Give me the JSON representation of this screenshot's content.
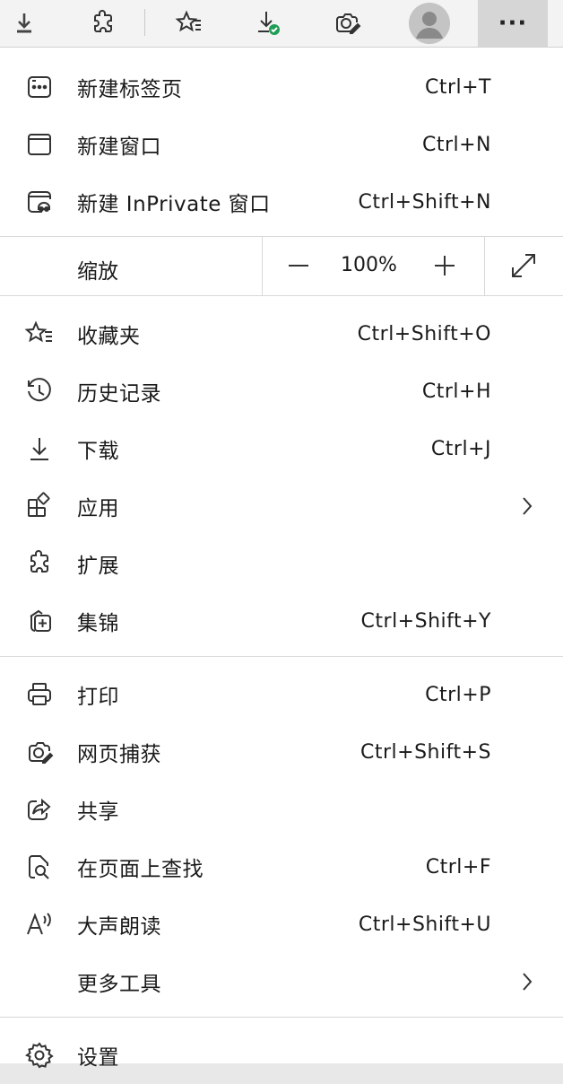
{
  "toolbar": {
    "buttons": [
      {
        "name": "download-arrow-icon"
      },
      {
        "name": "extensions-icon"
      },
      {
        "name": "favorites-icon"
      },
      {
        "name": "downloads-complete-icon"
      },
      {
        "name": "web-capture-icon"
      },
      {
        "name": "profile-avatar"
      },
      {
        "name": "more-options-icon",
        "label": "···"
      }
    ]
  },
  "menu": {
    "new_tab": {
      "label": "新建标签页",
      "shortcut": "Ctrl+T"
    },
    "new_window": {
      "label": "新建窗口",
      "shortcut": "Ctrl+N"
    },
    "new_inprivate": {
      "label": "新建 InPrivate 窗口",
      "shortcut": "Ctrl+Shift+N"
    },
    "zoom": {
      "label": "缩放",
      "minus": "—",
      "value": "100%",
      "plus": "+"
    },
    "favorites": {
      "label": "收藏夹",
      "shortcut": "Ctrl+Shift+O"
    },
    "history": {
      "label": "历史记录",
      "shortcut": "Ctrl+H"
    },
    "downloads": {
      "label": "下载",
      "shortcut": "Ctrl+J"
    },
    "apps": {
      "label": "应用"
    },
    "extensions": {
      "label": "扩展"
    },
    "collections": {
      "label": "集锦",
      "shortcut": "Ctrl+Shift+Y"
    },
    "print": {
      "label": "打印",
      "shortcut": "Ctrl+P"
    },
    "web_capture": {
      "label": "网页捕获",
      "shortcut": "Ctrl+Shift+S"
    },
    "share": {
      "label": "共享"
    },
    "find": {
      "label": "在页面上查找",
      "shortcut": "Ctrl+F"
    },
    "read_aloud": {
      "label": "大声朗读",
      "shortcut": "Ctrl+Shift+U"
    },
    "more_tools": {
      "label": "更多工具"
    },
    "settings": {
      "label": "设置"
    }
  },
  "colors": {
    "accent_check": "#1f9d55",
    "more_bg": "#d6d6d6"
  }
}
